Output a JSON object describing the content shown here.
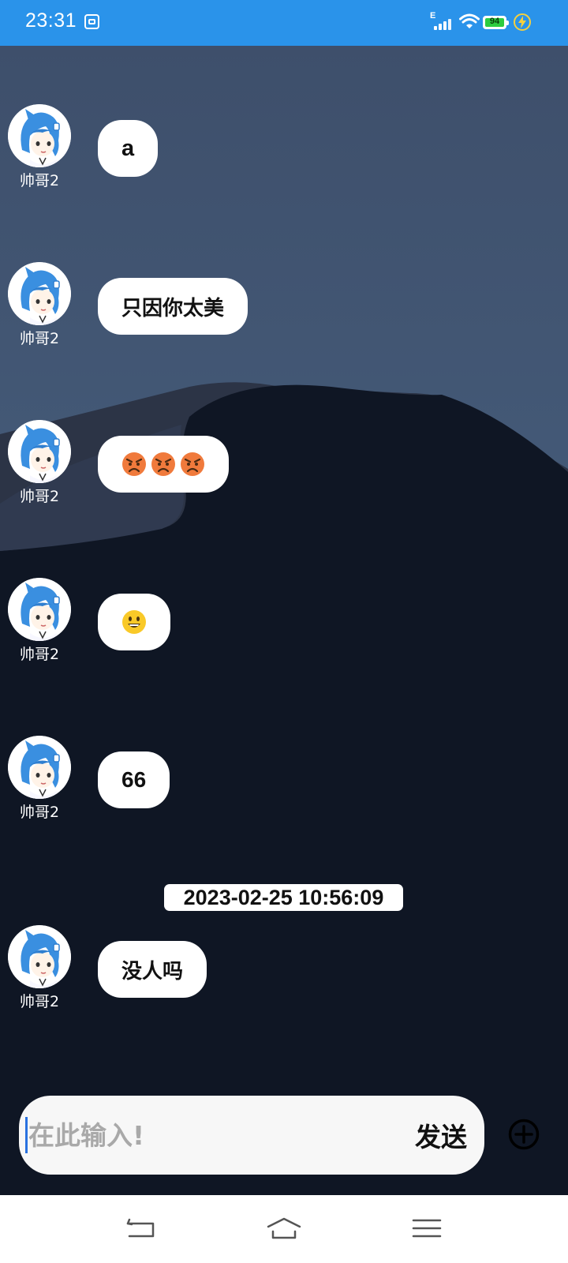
{
  "status_bar": {
    "time": "23:31",
    "network_type": "E",
    "battery_level": "94",
    "charging": true
  },
  "chat": {
    "messages": [
      {
        "sender": "帅哥2",
        "text": "a",
        "avatar": "avatar-icon"
      },
      {
        "sender": "帅哥2",
        "text": "只因你太美",
        "avatar": "avatar-icon"
      },
      {
        "sender": "帅哥2",
        "text": "😡😡😡",
        "avatar": "avatar-icon"
      },
      {
        "sender": "帅哥2",
        "text": "😃",
        "avatar": "avatar-icon"
      },
      {
        "sender": "帅哥2",
        "text": "66",
        "avatar": "avatar-icon"
      },
      {
        "sender": "帅哥2",
        "text": "没人吗",
        "avatar": "avatar-icon"
      }
    ],
    "timestamp": "2023-02-25 10:56:09"
  },
  "input": {
    "placeholder": "在此输入!",
    "value": "",
    "send_label": "发送",
    "add_icon": "plus-circle-icon"
  },
  "nav_bar": {
    "back_icon": "back-icon",
    "home_icon": "home-icon",
    "menu_icon": "menu-icon"
  },
  "colors": {
    "status_bar": "#2a93ea",
    "sky": "#40536f",
    "ground": "#0f1624",
    "bubble": "#ffffff",
    "input_bg": "#f7f7f7"
  }
}
